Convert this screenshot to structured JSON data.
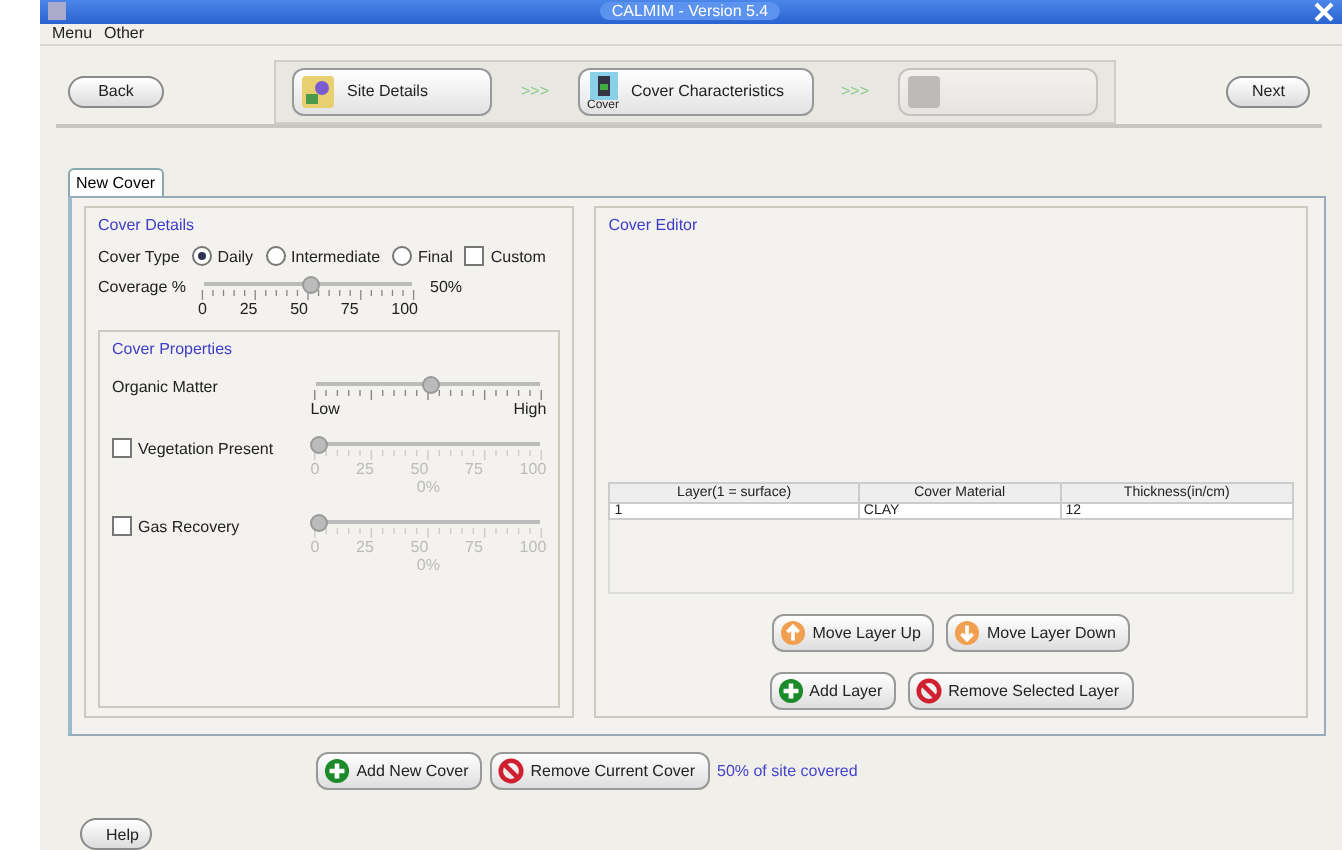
{
  "window": {
    "title": "CALMIM - Version 5.4"
  },
  "menu": [
    "Menu",
    "Other"
  ],
  "nav": {
    "back": "Back",
    "next": "Next",
    "separator": ">>>"
  },
  "steps": [
    {
      "label": "Site Details",
      "disabled": false
    },
    {
      "label": "Cover Characteristics",
      "caption": "Cover",
      "disabled": false
    },
    {
      "disabled": true
    }
  ],
  "tabs": [
    {
      "label": "New Cover",
      "selected": true
    }
  ],
  "cover_details": {
    "title": "Cover Details",
    "type_label": "Cover Type",
    "options": [
      {
        "kind": "radio",
        "label": "Daily",
        "selected": true
      },
      {
        "kind": "radio",
        "label": "Intermediate",
        "selected": false
      },
      {
        "kind": "radio",
        "label": "Final",
        "selected": false
      },
      {
        "kind": "checkbox",
        "label": "Custom",
        "checked": false
      }
    ],
    "coverage": {
      "label": "Coverage %",
      "level": 0.5,
      "ticks": [
        "0",
        "25",
        "50",
        "75",
        "100"
      ],
      "reading": "50%"
    }
  },
  "cover_properties": {
    "title": "Cover Properties",
    "rows": [
      {
        "kind": "low-high",
        "label": "Organic Matter",
        "level": 0.5,
        "ticks": [
          "Low",
          "High"
        ],
        "disabled": false
      },
      {
        "kind": "checkbox",
        "label": "Vegetation Present",
        "checked": false,
        "level": 0,
        "ticks": [
          "0",
          "25",
          "50",
          "75",
          "100"
        ],
        "reading": "0%",
        "disabled": true
      },
      {
        "kind": "checkbox",
        "label": "Gas Recovery",
        "checked": false,
        "level": 0,
        "ticks": [
          "0",
          "25",
          "50",
          "75",
          "100"
        ],
        "reading": "0%",
        "disabled": true
      }
    ]
  },
  "cover_editor": {
    "title": "Cover Editor",
    "columns": [
      "Layer(1 = surface)",
      "Cover Material",
      "Thickness(in/cm)"
    ],
    "rows": [
      [
        "1",
        "CLAY",
        "12"
      ]
    ],
    "buttons": [
      {
        "kind": "up",
        "label": "Move Layer Up"
      },
      {
        "kind": "down",
        "label": "Move Layer Down"
      },
      {
        "kind": "add",
        "label": "Add Layer"
      },
      {
        "kind": "remove",
        "label": "Remove Selected Layer"
      }
    ]
  },
  "footer": {
    "buttons": [
      {
        "kind": "add",
        "label": "Add New Cover"
      },
      {
        "kind": "remove",
        "label": "Remove Current Cover"
      }
    ],
    "status": "50% of site covered"
  },
  "help": "Help"
}
